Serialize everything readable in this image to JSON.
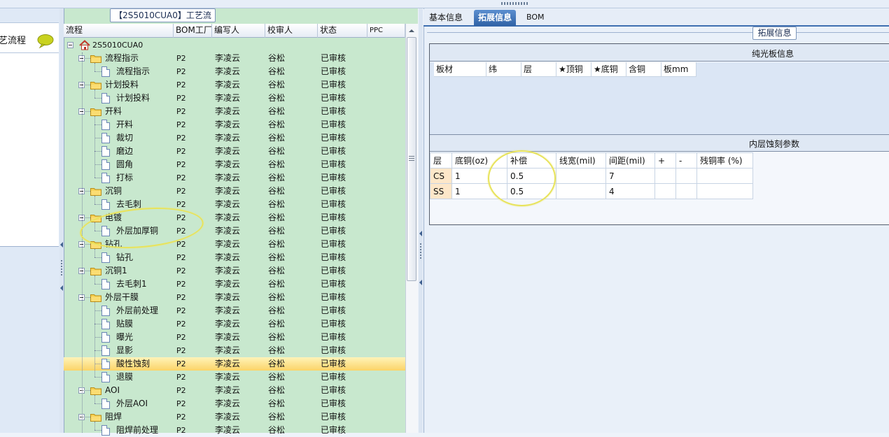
{
  "left_nav": {
    "label": "艺流程",
    "icon": "speech-bubble-icon"
  },
  "tree_panel": {
    "title": "【2S5010CUA0】工艺流程",
    "columns": [
      "流程",
      "BOM工厂",
      "编写人",
      "校审人",
      "状态",
      "PPC"
    ],
    "root_label": "2S5010CUA0",
    "rows": [
      {
        "label": "流程指示",
        "type": "folder",
        "bom": "P2",
        "writer": "李凌云",
        "checker": "谷松",
        "status": "已审核"
      },
      {
        "label": "流程指示",
        "type": "doc",
        "bom": "P2",
        "writer": "李凌云",
        "checker": "谷松",
        "status": "已审核"
      },
      {
        "label": "计划投料",
        "type": "folder",
        "bom": "P2",
        "writer": "李凌云",
        "checker": "谷松",
        "status": "已审核"
      },
      {
        "label": "计划投料",
        "type": "doc",
        "bom": "P2",
        "writer": "李凌云",
        "checker": "谷松",
        "status": "已审核"
      },
      {
        "label": "开料",
        "type": "folder",
        "bom": "P2",
        "writer": "李凌云",
        "checker": "谷松",
        "status": "已审核"
      },
      {
        "label": "开料",
        "type": "doc",
        "bom": "P2",
        "writer": "李凌云",
        "checker": "谷松",
        "status": "已审核"
      },
      {
        "label": "裁切",
        "type": "doc",
        "bom": "P2",
        "writer": "李凌云",
        "checker": "谷松",
        "status": "已审核"
      },
      {
        "label": "磨边",
        "type": "doc",
        "bom": "P2",
        "writer": "李凌云",
        "checker": "谷松",
        "status": "已审核"
      },
      {
        "label": "圆角",
        "type": "doc",
        "bom": "P2",
        "writer": "李凌云",
        "checker": "谷松",
        "status": "已审核"
      },
      {
        "label": "打标",
        "type": "doc",
        "bom": "P2",
        "writer": "李凌云",
        "checker": "谷松",
        "status": "已审核"
      },
      {
        "label": "沉铜",
        "type": "folder",
        "bom": "P2",
        "writer": "李凌云",
        "checker": "谷松",
        "status": "已审核"
      },
      {
        "label": "去毛刺",
        "type": "doc",
        "bom": "P2",
        "writer": "李凌云",
        "checker": "谷松",
        "status": "已审核"
      },
      {
        "label": "电镀",
        "type": "folder",
        "bom": "P2",
        "writer": "李凌云",
        "checker": "谷松",
        "status": "已审核"
      },
      {
        "label": "外层加厚铜",
        "type": "doc",
        "bom": "P2",
        "writer": "李凌云",
        "checker": "谷松",
        "status": "已审核"
      },
      {
        "label": "钻孔",
        "type": "folder",
        "bom": "P2",
        "writer": "李凌云",
        "checker": "谷松",
        "status": "已审核"
      },
      {
        "label": "钻孔",
        "type": "doc",
        "bom": "P2",
        "writer": "李凌云",
        "checker": "谷松",
        "status": "已审核"
      },
      {
        "label": "沉铜1",
        "type": "folder",
        "bom": "P2",
        "writer": "李凌云",
        "checker": "谷松",
        "status": "已审核"
      },
      {
        "label": "去毛刺1",
        "type": "doc",
        "bom": "P2",
        "writer": "李凌云",
        "checker": "谷松",
        "status": "已审核"
      },
      {
        "label": "外层干膜",
        "type": "folder",
        "bom": "P2",
        "writer": "李凌云",
        "checker": "谷松",
        "status": "已审核"
      },
      {
        "label": "外层前处理",
        "type": "doc",
        "bom": "P2",
        "writer": "李凌云",
        "checker": "谷松",
        "status": "已审核"
      },
      {
        "label": "贴膜",
        "type": "doc",
        "bom": "P2",
        "writer": "李凌云",
        "checker": "谷松",
        "status": "已审核"
      },
      {
        "label": "曝光",
        "type": "doc",
        "bom": "P2",
        "writer": "李凌云",
        "checker": "谷松",
        "status": "已审核"
      },
      {
        "label": "显影",
        "type": "doc",
        "bom": "P2",
        "writer": "李凌云",
        "checker": "谷松",
        "status": "已审核"
      },
      {
        "label": "酸性蚀刻",
        "type": "doc",
        "bom": "P2",
        "writer": "李凌云",
        "checker": "谷松",
        "status": "已审核",
        "selected": true
      },
      {
        "label": "退膜",
        "type": "doc",
        "bom": "P2",
        "writer": "李凌云",
        "checker": "谷松",
        "status": "已审核"
      },
      {
        "label": "AOI",
        "type": "folder",
        "bom": "P2",
        "writer": "李凌云",
        "checker": "谷松",
        "status": "已审核"
      },
      {
        "label": "外层AOI",
        "type": "doc",
        "bom": "P2",
        "writer": "李凌云",
        "checker": "谷松",
        "status": "已审核"
      },
      {
        "label": "阻焊",
        "type": "folder",
        "bom": "P2",
        "writer": "李凌云",
        "checker": "谷松",
        "status": "已审核"
      },
      {
        "label": "阻焊前处理",
        "type": "doc",
        "bom": "P2",
        "writer": "李凌云",
        "checker": "谷松",
        "status": "已审核"
      }
    ]
  },
  "tabs": [
    "基本信息",
    "拓展信息",
    "BOM"
  ],
  "active_tab": "拓展信息",
  "extended_info": {
    "caption": "拓展信息",
    "section1_title": "纯光板信息",
    "table1_columns": [
      "板材",
      "纬",
      "层",
      "★顶铜",
      "★底铜",
      "含铜",
      "板mm"
    ],
    "section2_title": "内层蚀刻参数",
    "table2_columns": [
      "层",
      "底铜(oz)",
      "补偿",
      "线宽(mil)",
      "间距(mil)",
      "+",
      "-",
      "残铜率 (%)"
    ],
    "table2_rows": [
      [
        "CS",
        "1",
        "0.5",
        "",
        "7",
        "",
        "",
        ""
      ],
      [
        "SS",
        "1",
        "0.5",
        "",
        "4",
        "",
        "",
        ""
      ]
    ]
  },
  "colors": {
    "tree_bg": "#c8e8ce",
    "selected_row": "#fbd468",
    "active_tab": "#2f62a6",
    "annotation": "#e8e35b"
  }
}
